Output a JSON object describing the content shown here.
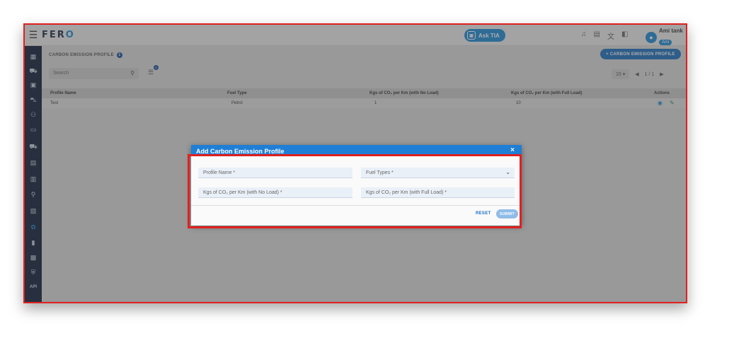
{
  "topbar": {
    "menu_icon": "hamburger-icon",
    "logo_text": "FER",
    "logo_accent": "O",
    "ask_label": "Ask TIA",
    "user_name": "Ami tank",
    "user_badge": "Ami"
  },
  "sidebar": {
    "icons": [
      "dashboard-icon",
      "car-icon",
      "bus-icon",
      "truck-icon",
      "people-icon",
      "id-card-icon",
      "van-icon",
      "wallet-icon",
      "building-icon",
      "route-icon",
      "tasks-icon",
      "gear-icon",
      "clipboard-icon",
      "dashboard2-icon",
      "shield-icon",
      "api-icon"
    ],
    "api_label": "API",
    "active_index": 11
  },
  "page": {
    "title": "CARBON EMISSION PROFILE",
    "count": "1",
    "add_button": "+ CARBON EMISSION PROFILE",
    "search_placeholder": "Search",
    "filter_count": "0",
    "page_size": "15",
    "page_info": "1 / 1"
  },
  "table": {
    "headers": [
      "Profile Name",
      "Fuel Type",
      "Kgs of CO₂ per Km (with No Load)",
      "Kgs of CO₂ per Km (with Full Load)",
      "Actions"
    ],
    "rows": [
      {
        "profile_name": "Test",
        "fuel_type": "Petrol",
        "no_load": "1",
        "full_load": "10"
      }
    ]
  },
  "modal": {
    "title": "Add Carbon Emission Profile",
    "close": "×",
    "profile_name_placeholder": "Profile Name *",
    "fuel_types_placeholder": "Fuel Types *",
    "no_load_placeholder": "Kgs of CO₂ per Km (with No Load) *",
    "full_load_placeholder": "Kgs of CO₂ per Km (with Full Load) *",
    "reset_label": "RESET",
    "submit_label": "SUBMIT"
  },
  "colors": {
    "accent": "#1a8bd8",
    "sidebar": "#0f1c3a",
    "highlight": "#e02020"
  }
}
